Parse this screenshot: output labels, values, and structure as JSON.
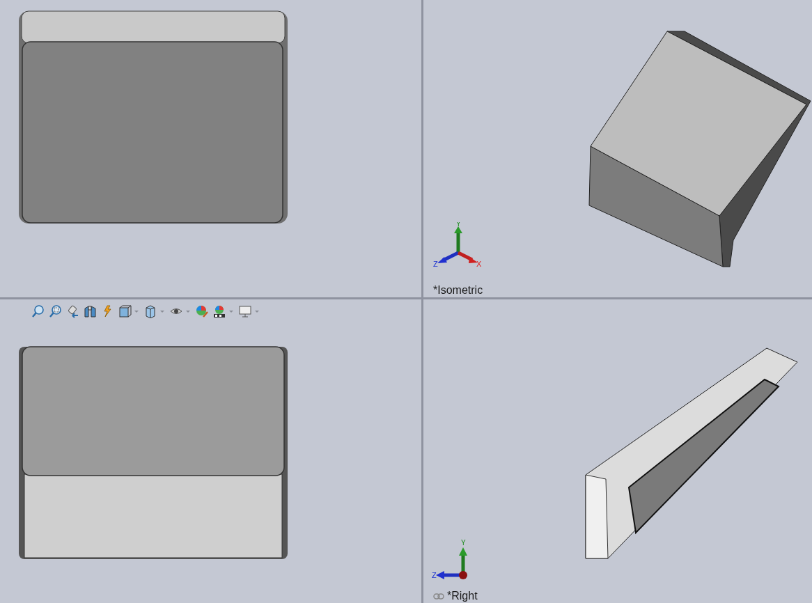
{
  "viewports": [
    {
      "kind": "front"
    },
    {
      "kind": "isometric",
      "label": "*Isometric",
      "linked": false,
      "triad": {
        "kind": "iso",
        "x": "X",
        "y": "Y",
        "z": "Z"
      }
    },
    {
      "kind": "top",
      "toolbar": [
        {
          "dropdown": false
        },
        {
          "dropdown": false
        },
        {
          "dropdown": false
        },
        {
          "dropdown": false
        },
        {
          "dropdown": false
        },
        {
          "dropdown": true
        },
        {
          "dropdown": true
        },
        {
          "dropdown": true
        },
        {
          "dropdown": false
        },
        {
          "dropdown": true
        },
        {
          "dropdown": true
        }
      ]
    },
    {
      "kind": "right",
      "label": "*Right",
      "linked": true,
      "triad": {
        "kind": "side",
        "y": "Y",
        "z": "Z"
      }
    }
  ]
}
